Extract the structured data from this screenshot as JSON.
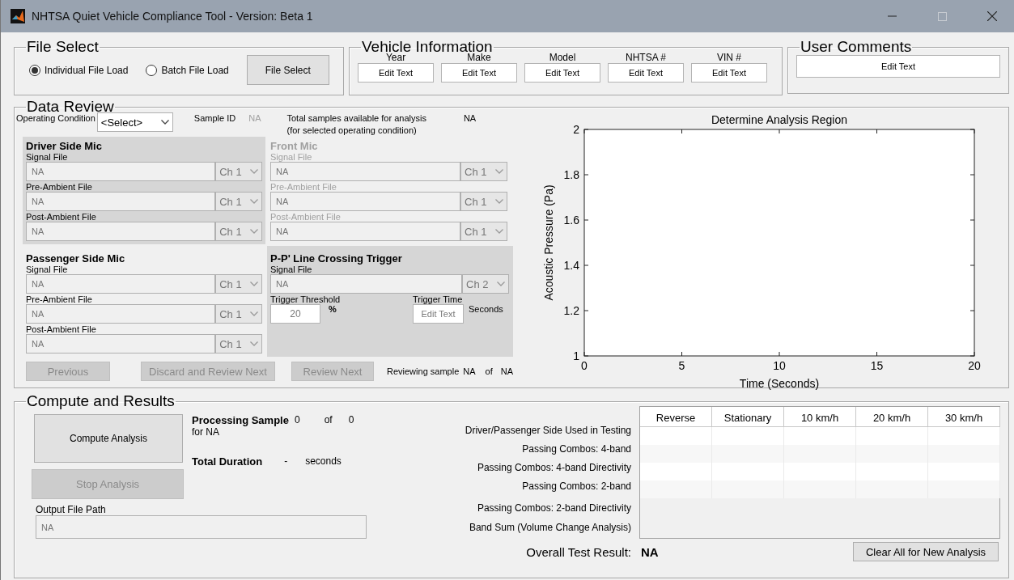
{
  "window": {
    "title": "NHTSA Quiet Vehicle Compliance Tool - Version: Beta 1"
  },
  "file_select": {
    "title": "File Select",
    "options": [
      {
        "label": "Individual File Load",
        "selected": true
      },
      {
        "label": "Batch File Load",
        "selected": false
      }
    ],
    "button": "File Select"
  },
  "vehicle_information": {
    "title": "Vehicle Information",
    "fields": [
      {
        "label": "Year",
        "value": "Edit Text"
      },
      {
        "label": "Make",
        "value": "Edit Text"
      },
      {
        "label": "Model",
        "value": "Edit Text"
      },
      {
        "label": "NHTSA #",
        "value": "Edit Text"
      },
      {
        "label": "VIN #",
        "value": "Edit Text"
      }
    ]
  },
  "user_comments": {
    "title": "User Comments",
    "value": "Edit Text"
  },
  "data_review": {
    "title": "Data Review",
    "operating_condition": {
      "label": "Operating Condition",
      "value": "<Select>"
    },
    "sample_id": {
      "label": "Sample ID",
      "value": "NA"
    },
    "total_samples": {
      "label": "Total samples available for analysis",
      "note": "(for selected operating condition)",
      "value": "NA"
    },
    "mics": [
      {
        "title": "Driver Side Mic",
        "disabled": false,
        "shaded": true,
        "files": [
          {
            "label": "Signal File",
            "value": "NA",
            "channel": "Ch 1"
          },
          {
            "label": "Pre-Ambient File",
            "value": "NA",
            "channel": "Ch 1"
          },
          {
            "label": "Post-Ambient File",
            "value": "NA",
            "channel": "Ch 1"
          }
        ]
      },
      {
        "title": "Front Mic",
        "disabled": true,
        "shaded": false,
        "files": [
          {
            "label": "Signal File",
            "value": "NA",
            "channel": "Ch 1"
          },
          {
            "label": "Pre-Ambient File",
            "value": "NA",
            "channel": "Ch 1"
          },
          {
            "label": "Post-Ambient File",
            "value": "NA",
            "channel": "Ch 1"
          }
        ]
      },
      {
        "title": "Passenger Side Mic",
        "disabled": false,
        "shaded": false,
        "files": [
          {
            "label": "Signal File",
            "value": "NA",
            "channel": "Ch 1"
          },
          {
            "label": "Pre-Ambient File",
            "value": "NA",
            "channel": "Ch 1"
          },
          {
            "label": "Post-Ambient File",
            "value": "NA",
            "channel": "Ch 1"
          }
        ]
      }
    ],
    "trigger": {
      "title": "P-P' Line Crossing Trigger",
      "file_label": "Signal File",
      "file_value": "NA",
      "channel": "Ch 2",
      "threshold_label": "Trigger Threshold",
      "threshold_value": "20",
      "threshold_unit": "%",
      "time_label": "Trigger Time",
      "time_value": "Edit Text",
      "time_unit": "Seconds"
    },
    "buttons": [
      {
        "label": "Previous",
        "disabled": true
      },
      {
        "label": "Discard and Review Next",
        "disabled": true
      },
      {
        "label": "Review Next",
        "disabled": true
      }
    ],
    "reviewing": {
      "label": "Reviewing sample",
      "current": "NA",
      "of": "of",
      "total": "NA"
    },
    "chart_data": {
      "type": "line",
      "title": "Determine Analysis Region",
      "xlabel": "Time (Seconds)",
      "ylabel": "Acoustic Pressure (Pa)",
      "xlim": [
        0,
        20
      ],
      "ylim": [
        1,
        2
      ],
      "xticks": [
        0,
        5,
        10,
        15,
        20
      ],
      "yticks": [
        1,
        1.2,
        1.4,
        1.6,
        1.8,
        2
      ]
    }
  },
  "compute": {
    "title": "Compute and Results",
    "compute_button": {
      "label": "Compute Analysis",
      "disabled": false
    },
    "stop_button": {
      "label": "Stop Analysis",
      "disabled": true
    },
    "output_path": {
      "label": "Output File Path",
      "value": "NA"
    },
    "processing": {
      "label": "Processing Sample",
      "current": "0",
      "of": "of",
      "total": "0",
      "for": "for NA"
    },
    "duration": {
      "label": "Total Duration",
      "value": "-",
      "unit": "seconds"
    },
    "row_labels": [
      "Driver/Passenger Side Used in Testing",
      "Passing Combos: 4-band",
      "Passing Combos: 4-band Directivity",
      "Passing Combos: 2-band",
      "Passing Combos: 2-band Directivity",
      "Band Sum (Volume Change Analysis)"
    ],
    "columns": [
      "Reverse",
      "Stationary",
      "10 km/h",
      "20 km/h",
      "30 km/h"
    ],
    "overall": {
      "label": "Overall Test Result:",
      "value": "NA"
    },
    "clear_button": "Clear All for New Analysis"
  }
}
